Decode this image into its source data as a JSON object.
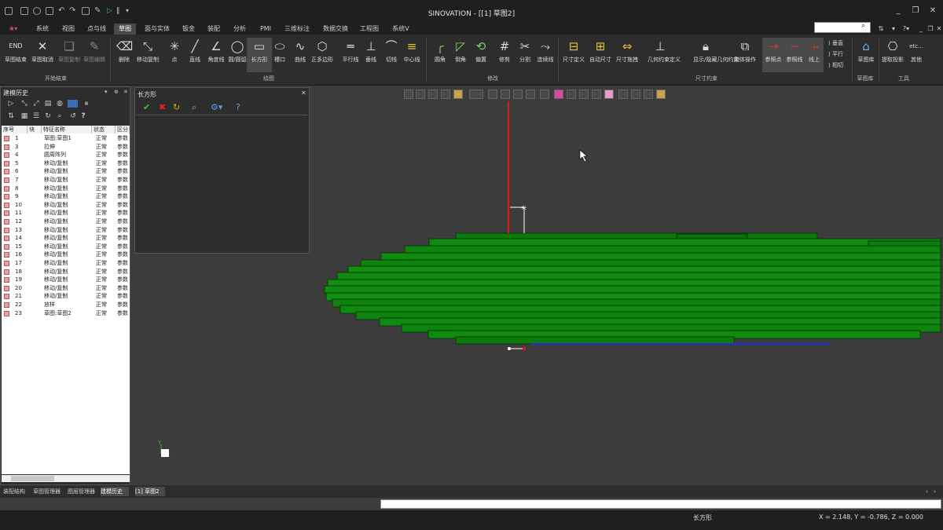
{
  "window": {
    "title": "SINOVATION - [[1] 草图2]"
  },
  "menu": {
    "tabs": [
      "系统",
      "视图",
      "点与线",
      "草图",
      "面与实体",
      "钣金",
      "装配",
      "分析",
      "PMI",
      "三维标注",
      "数据交换",
      "工程图",
      "系统V"
    ],
    "active_tab": "草图"
  },
  "ribbon": {
    "buttons": {
      "end": "END",
      "sketch_end": "草图结束",
      "sketch_cancel": "草图取消",
      "sketch_copy": "草图复制",
      "sketch_edit": "草图编辑",
      "delete": "删除",
      "move_copy": "移动复制",
      "point": "点",
      "line": "直线",
      "angle_line": "角度线",
      "circle_arc": "圆/圆弧",
      "rectangle": "长方形",
      "slot": "槽口",
      "curve": "曲线",
      "polygon": "正多边形",
      "parallel": "平行线",
      "perpendicular": "垂线",
      "tangent": "切线",
      "centerline": "中心线",
      "fillet": "圆角",
      "chamfer": "倒角",
      "offset": "偏置",
      "trim": "修剪",
      "split": "分割",
      "continuous_line": "连续线",
      "dim_define": "尺寸定义",
      "auto_dim": "自动尺寸",
      "dim_drag": "尺寸拖拽",
      "geo_constraint": "几何约束定义",
      "show_hide_constraint": "显示/隐藏几何约束",
      "rigid_op": "刚体操作",
      "ref_point": "参照点",
      "ref_line": "参照线",
      "on_line": "线上",
      "vertical": "垂直",
      "parallel_c": "平行",
      "tangent_c": "相切",
      "sketch_lib": "草图库",
      "extract_projection": "提取投影",
      "etc": "etc...",
      "other": "其他"
    },
    "groups": {
      "start_end": "开始结束",
      "draw": "绘图",
      "modify": "修改",
      "dim_constraint": "尺寸约束",
      "sketch_lib": "草图库",
      "tools": "工具"
    }
  },
  "history_panel": {
    "title": "建模历史",
    "columns": [
      "序号",
      "块",
      "特征名称",
      "状态",
      "区分"
    ],
    "rows": [
      {
        "n": "1",
        "name": "草图:草图1",
        "status": "正常",
        "type": "参数"
      },
      {
        "n": "3",
        "name": "拉伸",
        "status": "正常",
        "type": "参数"
      },
      {
        "n": "4",
        "name": "圆周阵列",
        "status": "正常",
        "type": "参数"
      },
      {
        "n": "5",
        "name": "移动/复制",
        "status": "正常",
        "type": "参数"
      },
      {
        "n": "6",
        "name": "移动/复制",
        "status": "正常",
        "type": "参数"
      },
      {
        "n": "7",
        "name": "移动/复制",
        "status": "正常",
        "type": "参数"
      },
      {
        "n": "8",
        "name": "移动/复制",
        "status": "正常",
        "type": "参数"
      },
      {
        "n": "9",
        "name": "移动/复制",
        "status": "正常",
        "type": "参数"
      },
      {
        "n": "10",
        "name": "移动/复制",
        "status": "正常",
        "type": "参数"
      },
      {
        "n": "11",
        "name": "移动/复制",
        "status": "正常",
        "type": "参数"
      },
      {
        "n": "12",
        "name": "移动/复制",
        "status": "正常",
        "type": "参数"
      },
      {
        "n": "13",
        "name": "移动/复制",
        "status": "正常",
        "type": "参数"
      },
      {
        "n": "14",
        "name": "移动/复制",
        "status": "正常",
        "type": "参数"
      },
      {
        "n": "15",
        "name": "移动/复制",
        "status": "正常",
        "type": "参数"
      },
      {
        "n": "16",
        "name": "移动/复制",
        "status": "正常",
        "type": "参数"
      },
      {
        "n": "17",
        "name": "移动/复制",
        "status": "正常",
        "type": "参数"
      },
      {
        "n": "18",
        "name": "移动/复制",
        "status": "正常",
        "type": "参数"
      },
      {
        "n": "19",
        "name": "移动/复制",
        "status": "正常",
        "type": "参数"
      },
      {
        "n": "20",
        "name": "移动/复制",
        "status": "正常",
        "type": "参数"
      },
      {
        "n": "21",
        "name": "移动/复制",
        "status": "正常",
        "type": "参数"
      },
      {
        "n": "22",
        "name": "放样",
        "status": "正常",
        "type": "参数"
      },
      {
        "n": "23",
        "name": "草图:草图2",
        "status": "正常",
        "type": "参数"
      }
    ]
  },
  "dialog": {
    "title": "长方形"
  },
  "bottom_tabs": [
    "装配结构",
    "草图管理器",
    "图层管理器",
    "建模历史"
  ],
  "bottom_tabs_active": "建模历史",
  "viewport_tab": "[1] 草图2",
  "status": {
    "mode": "长方形",
    "coords": "X =      2.148, Y =    -0.786, Z =      0.000"
  },
  "axis": {
    "y_label": "Y"
  }
}
